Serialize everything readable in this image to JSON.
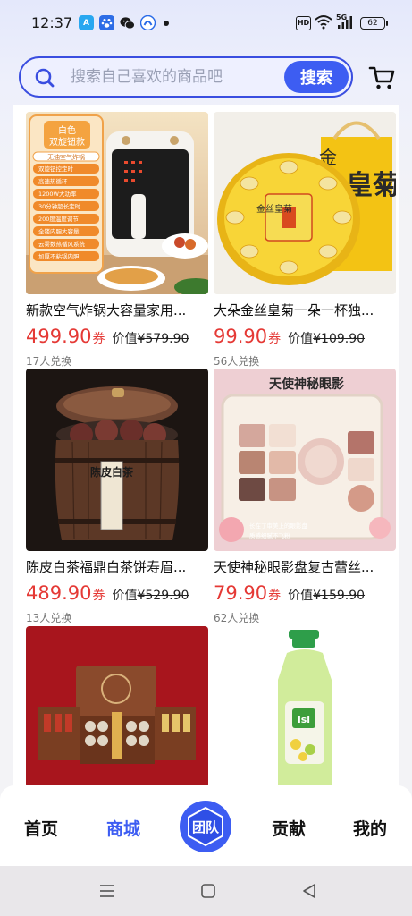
{
  "status_bar": {
    "time": "12:37",
    "battery": "62",
    "hd": "HD",
    "net": "5G"
  },
  "search": {
    "placeholder": "搜索自己喜欢的商品吧",
    "button_label": "搜索"
  },
  "products": [
    {
      "title": "新款空气炸锅大容量家用...",
      "price": "499.90",
      "coupon_suffix": "券",
      "value_label": "价值",
      "original_price": "¥579.90",
      "redeemed": "17人兑换",
      "image_text": {
        "line1": "白色",
        "line2": "双旋钮款",
        "line3": "一无油空气炸锅一",
        "features": [
          "双旋钮控定时",
          "高速热循环",
          "1200W大功率",
          "30分钟超长定时",
          "200度温度调节",
          "全镂内胆大容量",
          "云雾数热循风系统",
          "加厚不粘锅内胆"
        ]
      }
    },
    {
      "title": "大朵金丝皇菊一朵一杯独...",
      "price": "99.90",
      "coupon_suffix": "券",
      "value_label": "价值",
      "original_price": "¥109.90",
      "redeemed": "56人兑换",
      "image_text": {
        "bag": "皇菊",
        "bag_left": "金",
        "label": "金丝皇菊"
      }
    },
    {
      "title": "陈皮白茶福鼎白茶饼寿眉...",
      "price": "489.90",
      "coupon_suffix": "券",
      "value_label": "价值",
      "original_price": "¥529.90",
      "redeemed": "13人兑换",
      "image_text": {
        "label": "陈皮白茶"
      }
    },
    {
      "title": "天使神秘眼影盘复古蕾丝...",
      "price": "79.90",
      "coupon_suffix": "券",
      "value_label": "价值",
      "original_price": "¥159.90",
      "redeemed": "62人兑换",
      "image_text": {
        "headline": "天使神秘眼影",
        "caption1": "长在了审美上的眼影盘",
        "caption2": "质感细腻不飞粉"
      }
    },
    {
      "title": "",
      "image_text": {}
    },
    {
      "title": "",
      "image_text": {
        "bottle_label": "lsl"
      }
    }
  ],
  "bottom_nav": {
    "home": "首页",
    "mall": "商城",
    "team": "团队",
    "contribute": "贡献",
    "mine": "我的"
  },
  "colors": {
    "accent": "#3d5df2",
    "price_red": "#e53935"
  }
}
